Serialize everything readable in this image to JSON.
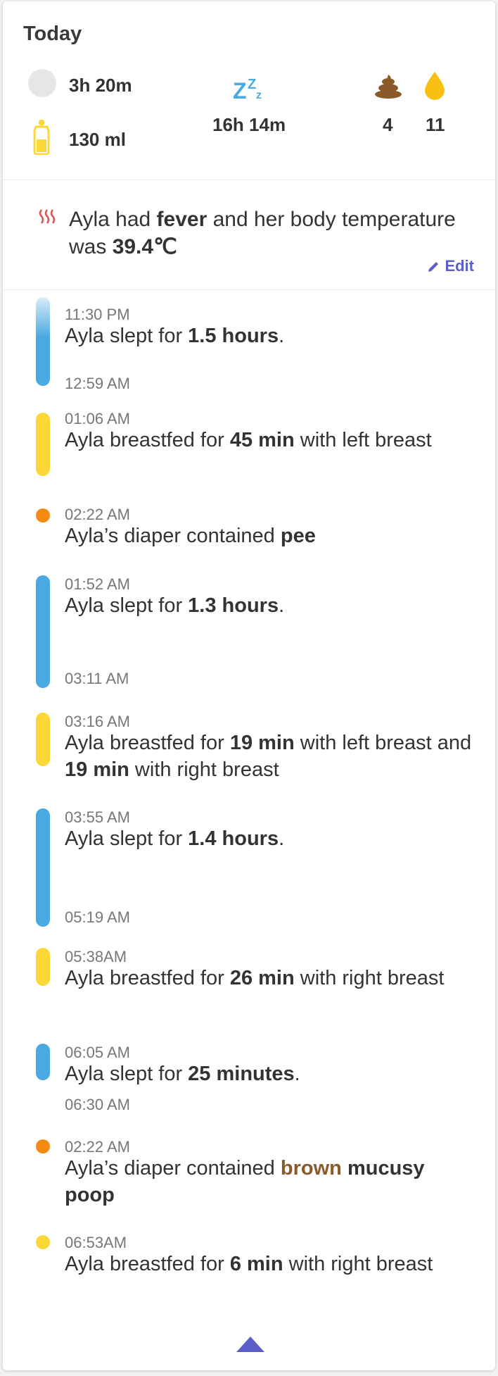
{
  "summary": {
    "title": "Today",
    "activity_duration": "3h 20m",
    "feeding_volume": "130 ml",
    "sleep_total": "16h 14m",
    "poop_count": "4",
    "pee_count": "11"
  },
  "fever": {
    "prefix": "Ayla had ",
    "keyword": "fever",
    "middle": " and her body temperature was ",
    "temperature": "39.4℃",
    "edit_label": "Edit"
  },
  "entries": [
    {
      "start": "11:30 PM",
      "end": "12:59 AM",
      "pre": "Ayla slept for ",
      "b1": "1.5 hours",
      "post": "."
    },
    {
      "start": "01:06 AM",
      "pre": "Ayla breastfed for ",
      "b1": "45 min",
      "post": " with left breast"
    },
    {
      "start": "02:22 AM",
      "pre": "Ayla’s diaper contained ",
      "b1": "pee",
      "post": ""
    },
    {
      "start": "01:52 AM",
      "end": "03:11 AM",
      "pre": "Ayla slept for ",
      "b1": "1.3 hours",
      "post": "."
    },
    {
      "start": "03:16 AM",
      "pre": "Ayla breastfed for ",
      "b1": "19 min",
      "mid": " with left breast and ",
      "b2": "19 min",
      "post": " with right breast"
    },
    {
      "start": "03:55 AM",
      "end": "05:19 AM",
      "pre": "Ayla slept for ",
      "b1": "1.4 hours",
      "post": "."
    },
    {
      "start": "05:38AM",
      "pre": "Ayla breastfed for ",
      "b1": "26 min",
      "post": " with right breast"
    },
    {
      "start": "06:05 AM",
      "end": "06:30 AM",
      "pre": "Ayla slept for ",
      "b1": "25 minutes",
      "post": "."
    },
    {
      "start": "02:22 AM",
      "pre": "Ayla’s diaper contained ",
      "color_word": "brown",
      "post": " ",
      "b1": "mucusy poop"
    },
    {
      "start": "06:53AM",
      "pre": "Ayla breastfed for ",
      "b1": "6 min",
      "post": " with right breast"
    }
  ],
  "colors": {
    "sleep": "#4aa9e0",
    "feed": "#fbd838",
    "diaper": "#f38a12",
    "accent": "#5b5fc7",
    "poop_brown": "#8b5a2b",
    "fever_red": "#d9534f"
  },
  "icons": [
    "circle-icon",
    "bottle-icon",
    "sleep-zzz-icon",
    "poop-icon",
    "pee-drop-icon",
    "fever-heat-icon",
    "pencil-icon",
    "collapse-arrow-icon"
  ]
}
